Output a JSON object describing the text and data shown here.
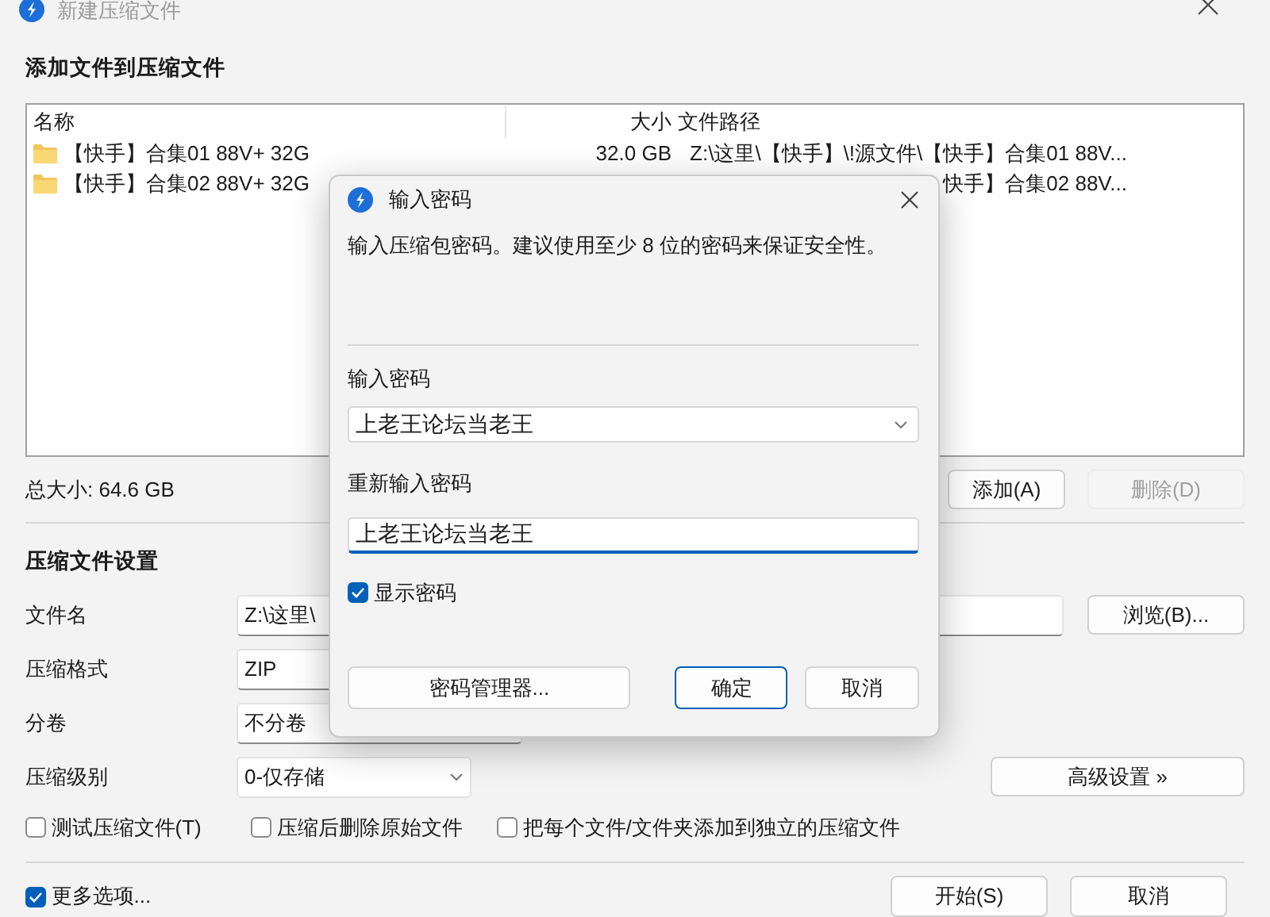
{
  "window": {
    "title": "新建压缩文件"
  },
  "files": {
    "heading": "添加文件到压缩文件",
    "columns": [
      "名称",
      "大小",
      "文件路径"
    ],
    "rows": [
      {
        "name": "【快手】合集01 88V+ 32G",
        "size": "32.0 GB",
        "path": "Z:\\这里\\【快手】\\!源文件\\【快手】合集01 88V..."
      },
      {
        "name": "【快手】合集02 88V+ 32G",
        "path": "快手】合集02 88V..."
      }
    ]
  },
  "total": "总大小: 64.6 GB",
  "file_buttons": [
    {
      "label": "添加(A)",
      "disabled": false
    },
    {
      "label": "删除(D)",
      "disabled": true
    }
  ],
  "settings": {
    "heading": "压缩文件设置",
    "fields": [
      {
        "label": "文件名",
        "value": "Z:\\这里\\",
        "kind": "wide",
        "button": "浏览(B)..."
      },
      {
        "label": "压缩格式",
        "value": "ZIP",
        "kind": "text"
      },
      {
        "label": "分卷",
        "value": "不分卷",
        "kind": "text"
      },
      {
        "label": "压缩级别",
        "value": "0-仅存储",
        "kind": "select",
        "button": "高级设置 »"
      }
    ]
  },
  "options": [
    {
      "label": "测试压缩文件(T)",
      "checked": false
    },
    {
      "label": "压缩后删除原始文件",
      "checked": false
    },
    {
      "label": "把每个文件/文件夹添加到独立的压缩文件",
      "checked": false
    }
  ],
  "more_options": {
    "label": "更多选项...",
    "checked": true
  },
  "actions": [
    {
      "label": "开始(S)"
    },
    {
      "label": "取消"
    }
  ],
  "dialog": {
    "title": "输入密码",
    "description": "输入压缩包密码。建议使用至少 8 位的密码来保证安全性。",
    "password_label": "输入密码",
    "password_value": "上老王论坛当老王",
    "confirm_label": "重新输入密码",
    "confirm_value": "上老王论坛当老王",
    "show_password": {
      "label": "显示密码",
      "checked": true
    },
    "buttons": [
      {
        "label": "密码管理器...",
        "kind": "plain"
      },
      {
        "label": "确定",
        "kind": "default"
      },
      {
        "label": "取消",
        "kind": "plain"
      }
    ]
  }
}
